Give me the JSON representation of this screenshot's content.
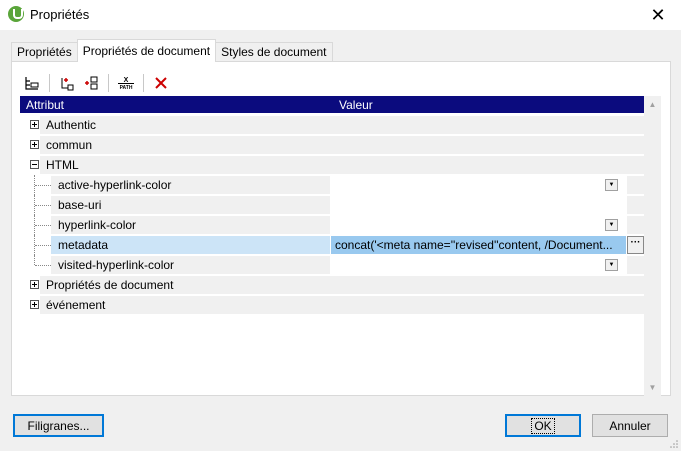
{
  "window": {
    "title": "Propriétés",
    "close_glyph": "✕"
  },
  "tabs": [
    {
      "label": "Propriétés",
      "active": false
    },
    {
      "label": "Propriétés de document",
      "active": true
    },
    {
      "label": "Styles de document",
      "active": false
    }
  ],
  "toolbar": {
    "icons": [
      "tree-view-icon",
      "add-child-icon",
      "add-sibling-icon",
      "xpath-icon",
      "delete-icon"
    ],
    "xpath_text": "PATH",
    "delete_color": "#cc0000"
  },
  "grid": {
    "header": {
      "attribute": "Attribut",
      "value": "Valeur",
      "bg_color": "#0b0b7e"
    },
    "rows": [
      {
        "label": "Authentic",
        "expanded": false
      },
      {
        "label": "commun",
        "expanded": false
      },
      {
        "label": "HTML",
        "expanded": true
      },
      {
        "label": "active-hyperlink-color",
        "value": "",
        "control": "dropdown"
      },
      {
        "label": "base-uri",
        "value": ""
      },
      {
        "label": "hyperlink-color",
        "value": "",
        "control": "dropdown"
      },
      {
        "label": "metadata",
        "value": "concat('<meta name=''revised''content, /Document...",
        "control": "ellipsis",
        "selected": true
      },
      {
        "label": "visited-hyperlink-color",
        "value": "",
        "control": "dropdown"
      },
      {
        "label": "Propriétés de document",
        "expanded": false
      },
      {
        "label": "événement",
        "expanded": false
      }
    ]
  },
  "buttons": {
    "filigranes": "Filigranes...",
    "ok": "OK",
    "annuler": "Annuler"
  },
  "colors": {
    "accent": "#0078d7",
    "selected_row": "#cce4f7",
    "selected_value": "#99c9ef",
    "app_icon": "#5aa53a"
  }
}
